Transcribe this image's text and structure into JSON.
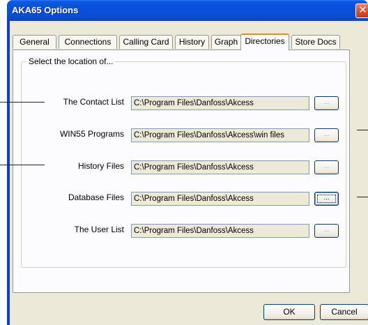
{
  "window": {
    "title": "AKA65 Options",
    "close_glyph": "✕"
  },
  "tabs": [
    {
      "label": "General"
    },
    {
      "label": "Connections"
    },
    {
      "label": "Calling Card"
    },
    {
      "label": "History"
    },
    {
      "label": "Graph"
    },
    {
      "label": "Directories",
      "active": true
    },
    {
      "label": "Store Docs"
    }
  ],
  "directories": {
    "group_label": "Select the location of...",
    "browse_label": "...",
    "rows": [
      {
        "label": "The Contact List",
        "path": "C:\\Program Files\\Danfoss\\Akcess"
      },
      {
        "label": "WIN55 Programs",
        "path": "C:\\Program Files\\Danfoss\\Akcess\\win files"
      },
      {
        "label": "History Files",
        "path": "C:\\Program Files\\Danfoss\\Akcess"
      },
      {
        "label": "Database Files",
        "path": "C:\\Program Files\\Danfoss\\Akcess",
        "browse_focused": true
      },
      {
        "label": "The User List",
        "path": "C:\\Program Files\\Danfoss\\Akcess"
      }
    ]
  },
  "buttons": {
    "ok": "OK",
    "cancel": "Cancel"
  },
  "colors": {
    "title_bar": "#0a4fd8",
    "dialog_bg": "#ece9d8",
    "active_tab_accent": "#e68b2c"
  }
}
